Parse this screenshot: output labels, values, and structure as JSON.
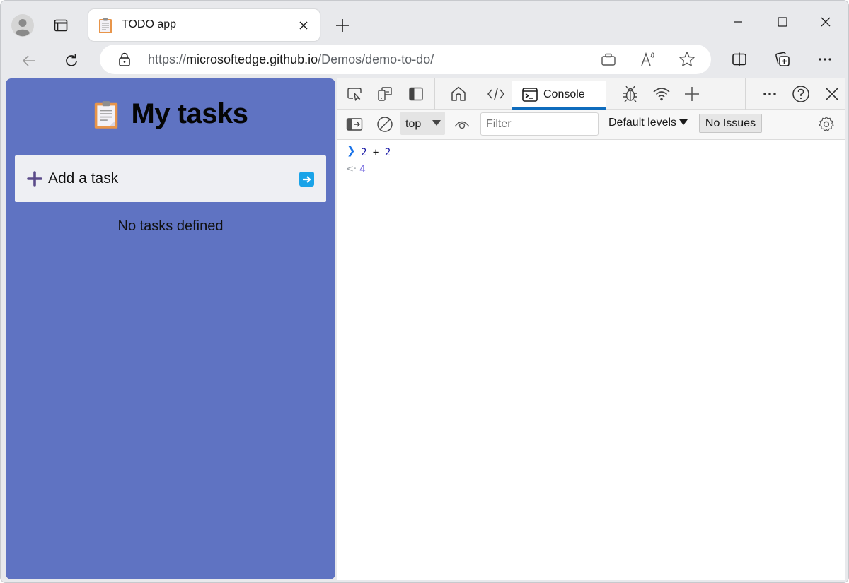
{
  "browser": {
    "tab": {
      "title": "TODO app",
      "favicon": "clipboard-icon"
    },
    "address": {
      "scheme": "https://",
      "host": "microsoftedge.github.io",
      "path": "/Demos/demo-to-do/"
    },
    "toolbar_icons": [
      "back-icon",
      "refresh-icon",
      "lock-icon",
      "app-available-icon",
      "read-aloud-icon",
      "favorite-star-icon",
      "split-screen-icon",
      "collections-icon",
      "more-icon"
    ]
  },
  "webpage": {
    "title": "My tasks",
    "title_icon": "clipboard-icon",
    "add_task_label": "Add a task",
    "empty_message": "No tasks defined",
    "background_color": "#5f73c2",
    "submit_color": "#1aa3e8"
  },
  "devtools": {
    "tabs": [
      {
        "name": "inspect",
        "icon": "inspect-icon"
      },
      {
        "name": "device-emulation",
        "icon": "device-icon"
      },
      {
        "name": "dock",
        "icon": "dock-icon"
      },
      {
        "name": "welcome",
        "icon": "home-icon"
      },
      {
        "name": "elements",
        "icon": "code-icon"
      },
      {
        "name": "console",
        "label": "Console",
        "icon": "console-icon",
        "active": true
      },
      {
        "name": "sources",
        "icon": "bug-icon"
      },
      {
        "name": "network",
        "icon": "wifi-icon"
      },
      {
        "name": "more-tools",
        "icon": "plus-icon"
      }
    ],
    "console_label": "Console",
    "toolbar": {
      "context": "top",
      "filter_placeholder": "Filter",
      "filter_value": "",
      "levels_label": "Default levels",
      "issues_label": "No Issues"
    },
    "console": {
      "input": {
        "left": "2",
        "operator": "+",
        "right": "2"
      },
      "output": "4"
    },
    "accent_color": "#0f6cbd"
  }
}
